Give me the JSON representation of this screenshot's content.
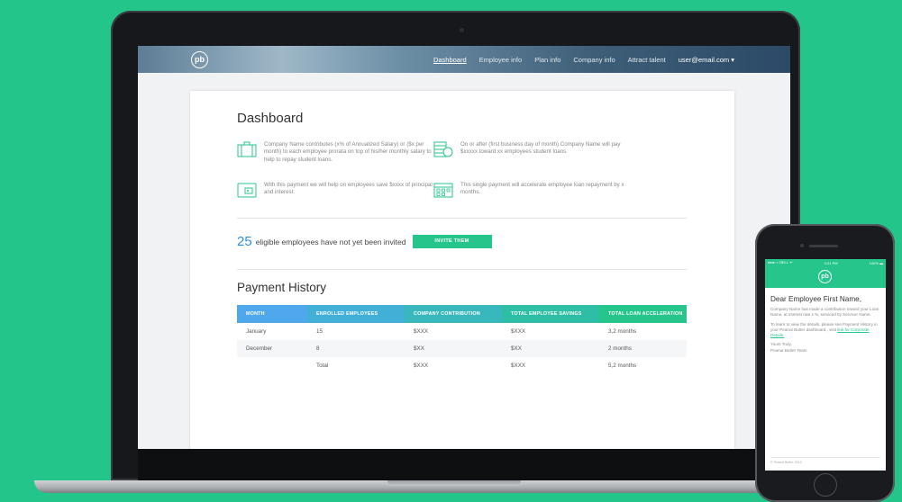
{
  "nav": {
    "logo": "pb",
    "links": [
      "Dashboard",
      "Employee info",
      "Plan info",
      "Company info",
      "Attract talent"
    ],
    "user": "user@email.com ▾"
  },
  "dashboard": {
    "title": "Dashboard",
    "info": [
      {
        "icon": "briefcase-icon",
        "text": "Company Name contributes (x% of Annualized Salary) or ($x per month) to each employee prorata on top of his/her monthly salary to help to repay student loans."
      },
      {
        "icon": "coins-icon",
        "text": "On or after (first business day of month) Company Name will pay $xxxxx toward xx employees student loans."
      },
      {
        "icon": "wallet-icon",
        "text": "With this payment we will help on employees save $xxxx of principal and interest."
      },
      {
        "icon": "calendar-icon",
        "text": "This single payment will accelerate employee loan repayment by x months."
      }
    ],
    "eligible": {
      "count": "25",
      "text": "eligible employees have not yet been invited",
      "button": "INVITE THEM"
    }
  },
  "payment_history": {
    "title": "Payment History",
    "columns": [
      "MONTH",
      "ENROLLED EMPLOYEES",
      "COMPANY CONTRIBUTION",
      "TOTAL EMPLOYEE SAVINGS",
      "TOTAL LOAN ACCELERATION"
    ],
    "rows": [
      [
        "January",
        "15",
        "$XXX",
        "$XXX",
        "3,2 months"
      ],
      [
        "December",
        "8",
        "$XX",
        "$XX",
        "2 months"
      ],
      [
        "",
        "Total",
        "$XXX",
        "$XXX",
        "5,2 months"
      ]
    ]
  },
  "phone": {
    "status_left": "●●●○○ BELL ᯤ",
    "status_time": "4:21 PM",
    "status_right": "100% ▬",
    "logo": "pb",
    "greeting": "Dear Employee First Name,",
    "p1": "Company Name has made a contribution toward your Loan Name, at interest rate x %, serviced by Servicer Name.",
    "p2_prefix": "To learn to view the details, please see Payment History in your Peanut Butter dashboard., visit ",
    "p2_link": "link for Corporate Details.",
    "signoff": "Yours Truly,",
    "team": "Peanut Butter Team",
    "footer": "© Peanut Butter 2015"
  },
  "colors": {
    "background": "#24c58a",
    "accent": "#25c58b",
    "highlight_number": "#2f8fe0",
    "table_header_start": "#4fa8ec",
    "table_header_end": "#25c58b"
  }
}
